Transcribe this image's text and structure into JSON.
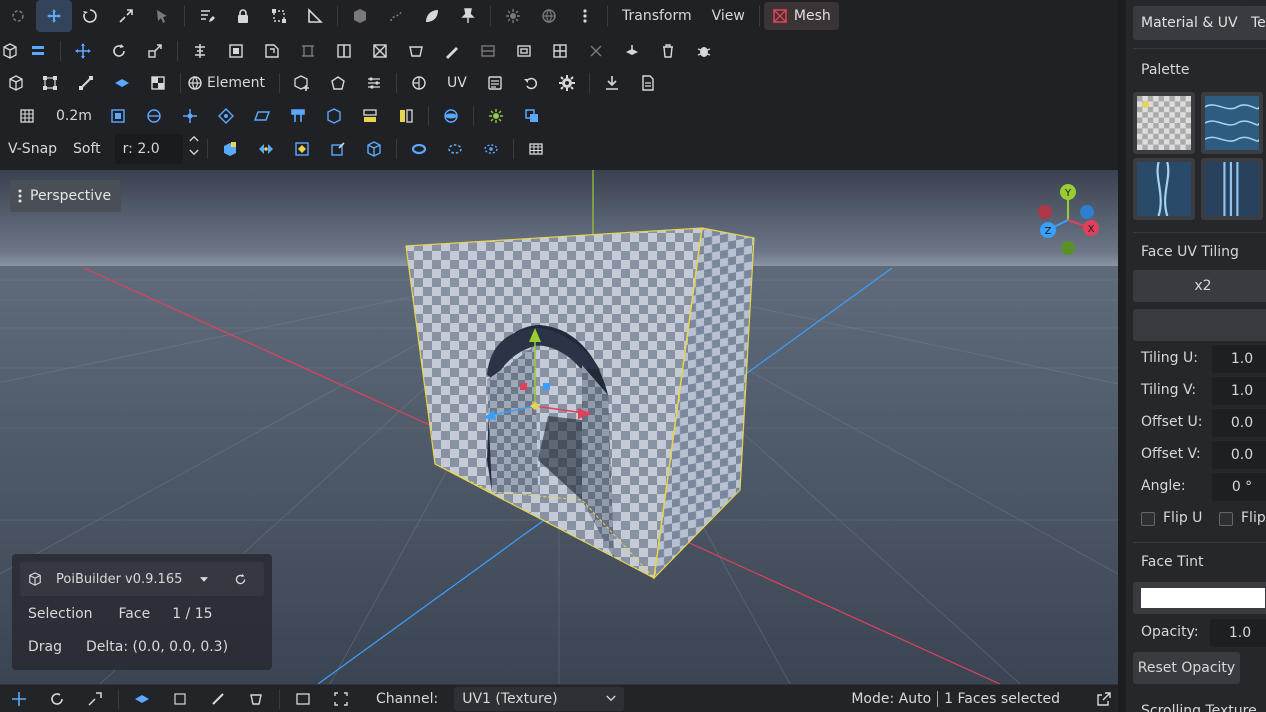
{
  "toolbar": {
    "transform_label": "Transform",
    "view_label": "View",
    "mesh_label": "Mesh",
    "element_label": "Element",
    "uv_label": "UV",
    "grid_size": "0.2m",
    "vsnap_label": "V-Snap",
    "soft_label": "Soft",
    "radius_value": "r: 2.0"
  },
  "viewport": {
    "camera_label": "Perspective",
    "gizmo": {
      "y": "Y",
      "x": "X",
      "z": "Z"
    }
  },
  "info_panel": {
    "app_name": "PoiBuilder v0.9.165",
    "selection_label": "Selection",
    "selection_mode": "Face",
    "selection_count": "1 / 15",
    "drag_label": "Drag",
    "drag_delta": "Delta: (0.0, 0.0, 0.3)"
  },
  "statusbar": {
    "channel_label": "Channel:",
    "channel_value": "UV1 (Texture)",
    "mode_text": "Mode: Auto",
    "faces_text": "1 Faces selected"
  },
  "side_panel": {
    "tab_material": "Material & UV",
    "tab_texture": "Te",
    "palette_title": "Palette",
    "face_uv_title": "Face UV Tiling",
    "x2_label": "x2",
    "tiling_u_label": "Tiling U:",
    "tiling_u_value": "1.0",
    "tiling_v_label": "Tiling V:",
    "tiling_v_value": "1.0",
    "offset_u_label": "Offset U:",
    "offset_u_value": "0.0",
    "offset_v_label": "Offset V:",
    "offset_v_value": "0.0",
    "angle_label": "Angle:",
    "angle_value": "0 °",
    "flip_u_label": "Flip U",
    "flip_v_label": "Flip",
    "face_tint_title": "Face Tint",
    "tint_color": "#ffffff",
    "opacity_label": "Opacity:",
    "opacity_value": "1.0",
    "reset_opacity_label": "Reset Opacity",
    "scrolling_label": "Scrolling Texture"
  },
  "colors": {
    "accent": "#5aa8ff",
    "selection": "#e8d44d",
    "axis_x": "#e0405a",
    "axis_y": "#9acd32",
    "axis_z": "#3aa0ff"
  }
}
